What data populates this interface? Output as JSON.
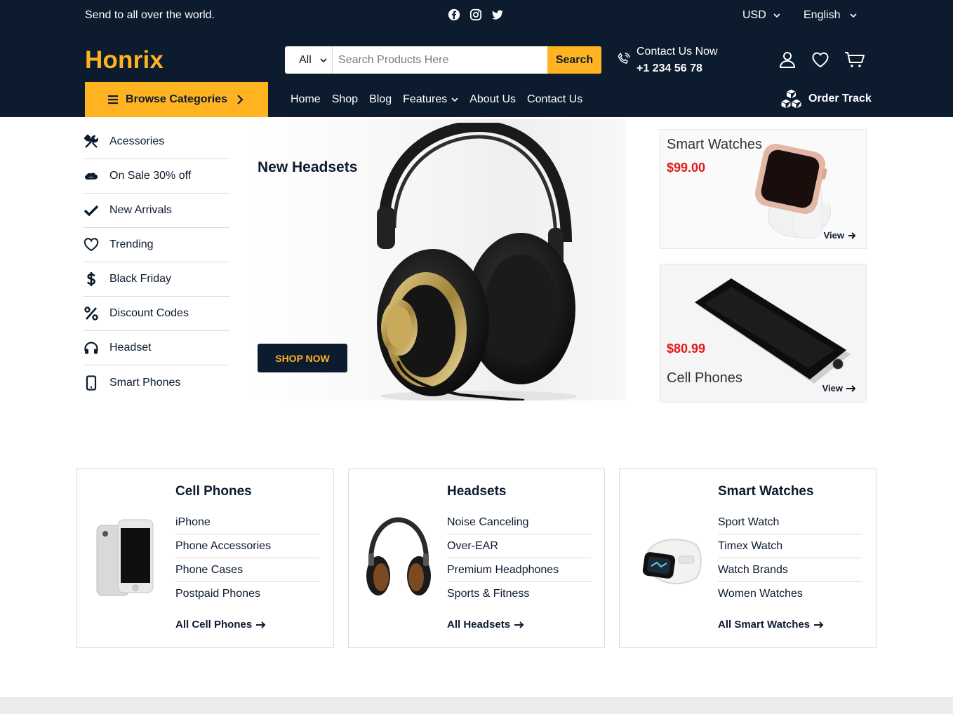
{
  "topbar": {
    "tagline": "Send to all over the world.",
    "social_icons": [
      "facebook-icon",
      "instagram-icon",
      "twitter-icon"
    ],
    "currency": "USD",
    "language": "English"
  },
  "brand": {
    "logo": "Honrix",
    "accent_color": "#ffb321",
    "dark_color": "#0c1b2e"
  },
  "search": {
    "category": "All",
    "placeholder": "Search Products Here",
    "button": "Search"
  },
  "contact": {
    "label": "Contact Us Now",
    "phone": "+1 234 56 78"
  },
  "header_icons": [
    "user-icon",
    "heart-icon",
    "cart-icon"
  ],
  "browse": {
    "label": "Browse Categories"
  },
  "nav": {
    "items": [
      "Home",
      "Shop",
      "Blog",
      "Features",
      "About Us",
      "Contact Us"
    ],
    "order_track": "Order Track"
  },
  "sidebar": {
    "items": [
      {
        "label": "Acessories",
        "icon": "tools-icon"
      },
      {
        "label": "On Sale 30% off",
        "icon": "salesforce-cloud-icon"
      },
      {
        "label": "New Arrivals",
        "icon": "check-icon"
      },
      {
        "label": "Trending",
        "icon": "heart-icon"
      },
      {
        "label": "Black Friday",
        "icon": "dollar-icon"
      },
      {
        "label": "Discount Codes",
        "icon": "percent-icon"
      },
      {
        "label": "Headset",
        "icon": "headphones-icon"
      },
      {
        "label": "Smart Phones",
        "icon": "mobile-icon"
      }
    ]
  },
  "hero": {
    "title": "New Headsets",
    "button": "SHOP NOW"
  },
  "promos": [
    {
      "title": "Smart Watches",
      "price": "$99.00",
      "link": "View"
    },
    {
      "title": "Cell Phones",
      "price": "$80.99",
      "link": "View"
    }
  ],
  "categories": [
    {
      "title": "Cell Phones",
      "items": [
        "iPhone",
        "Phone Accessories",
        "Phone Cases",
        "Postpaid Phones"
      ],
      "all_link": "All Cell Phones"
    },
    {
      "title": "Headsets",
      "items": [
        "Noise Canceling",
        "Over-EAR",
        "Premium Headphones",
        "Sports & Fitness"
      ],
      "all_link": "All Headsets"
    },
    {
      "title": "Smart Watches",
      "items": [
        "Sport Watch",
        "Timex Watch",
        "Watch Brands",
        "Women Watches"
      ],
      "all_link": "All Smart Watches"
    }
  ],
  "price_color": "#e21b1b"
}
